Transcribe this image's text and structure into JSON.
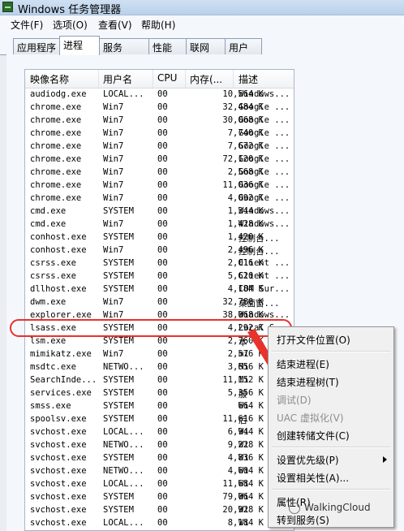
{
  "window": {
    "title": "Windows 任务管理器"
  },
  "menu": [
    "文件(F)",
    "选项(O)",
    "查看(V)",
    "帮助(H)"
  ],
  "tabs": [
    "应用程序",
    "进程",
    "服务",
    "性能",
    "联网",
    "用户"
  ],
  "active_tab": "进程",
  "columns": [
    "映像名称",
    "用户名",
    "CPU",
    "内存(...",
    "描述"
  ],
  "processes": [
    {
      "name": "audiodg.exe",
      "user": "LOCAL...",
      "cpu": "00",
      "mem": "10,564 K",
      "desc": "Windows..."
    },
    {
      "name": "chrome.exe",
      "user": "Win7",
      "cpu": "00",
      "mem": "32,484 K",
      "desc": "Google ..."
    },
    {
      "name": "chrome.exe",
      "user": "Win7",
      "cpu": "00",
      "mem": "30,068 K",
      "desc": "Google ..."
    },
    {
      "name": "chrome.exe",
      "user": "Win7",
      "cpu": "00",
      "mem": "7,740 K",
      "desc": "Google ..."
    },
    {
      "name": "chrome.exe",
      "user": "Win7",
      "cpu": "00",
      "mem": "7,672 K",
      "desc": "Google ..."
    },
    {
      "name": "chrome.exe",
      "user": "Win7",
      "cpu": "00",
      "mem": "72,120 K",
      "desc": "Google ..."
    },
    {
      "name": "chrome.exe",
      "user": "Win7",
      "cpu": "00",
      "mem": "2,568 K",
      "desc": "Google ..."
    },
    {
      "name": "chrome.exe",
      "user": "Win7",
      "cpu": "00",
      "mem": "11,036 K",
      "desc": "Google ..."
    },
    {
      "name": "chrome.exe",
      "user": "Win7",
      "cpu": "00",
      "mem": "4,092 K",
      "desc": "Google ..."
    },
    {
      "name": "cmd.exe",
      "user": "SYSTEM",
      "cpu": "00",
      "mem": "1,344 K",
      "desc": "Windows..."
    },
    {
      "name": "cmd.exe",
      "user": "Win7",
      "cpu": "00",
      "mem": "1,428 K",
      "desc": "Windows..."
    },
    {
      "name": "conhost.exe",
      "user": "SYSTEM",
      "cpu": "00",
      "mem": "1,420 K",
      "desc": "控制台..."
    },
    {
      "name": "conhost.exe",
      "user": "Win7",
      "cpu": "00",
      "mem": "2,496 K",
      "desc": "控制台..."
    },
    {
      "name": "csrss.exe",
      "user": "SYSTEM",
      "cpu": "00",
      "mem": "2,016 K",
      "desc": "Client ..."
    },
    {
      "name": "csrss.exe",
      "user": "SYSTEM",
      "cpu": "00",
      "mem": "5,620 K",
      "desc": "Client ..."
    },
    {
      "name": "dllhost.exe",
      "user": "SYSTEM",
      "cpu": "00",
      "mem": "4,184 K",
      "desc": "COM Sur..."
    },
    {
      "name": "dwm.exe",
      "user": "Win7",
      "cpu": "00",
      "mem": "32,780 K",
      "desc": "桌面窗..."
    },
    {
      "name": "explorer.exe",
      "user": "Win7",
      "cpu": "00",
      "mem": "38,068 K",
      "desc": "Windows..."
    },
    {
      "name": "lsass.exe",
      "user": "SYSTEM",
      "cpu": "00",
      "mem": "4,292 K",
      "desc": "Local S..."
    },
    {
      "name": "lsm.exe",
      "user": "SYSTEM",
      "cpu": "00",
      "mem": "2,760 K",
      "desc": "本"
    },
    {
      "name": "mimikatz.exe",
      "user": "Win7",
      "cpu": "00",
      "mem": "2,576 K",
      "desc": "mi"
    },
    {
      "name": "msdtc.exe",
      "user": "NETWO...",
      "cpu": "00",
      "mem": "3,656 K",
      "desc": "Mi"
    },
    {
      "name": "SearchInde...",
      "user": "SYSTEM",
      "cpu": "00",
      "mem": "11,152 K",
      "desc": "Mi"
    },
    {
      "name": "services.exe",
      "user": "SYSTEM",
      "cpu": "00",
      "mem": "5,356 K",
      "desc": "服"
    },
    {
      "name": "smss.exe",
      "user": "SYSTEM",
      "cpu": "00",
      "mem": "664 K",
      "desc": "Wi"
    },
    {
      "name": "spoolsv.exe",
      "user": "SYSTEM",
      "cpu": "00",
      "mem": "11,616 K",
      "desc": "后"
    },
    {
      "name": "svchost.exe",
      "user": "LOCAL...",
      "cpu": "00",
      "mem": "6,944 K",
      "desc": "Wi"
    },
    {
      "name": "svchost.exe",
      "user": "NETWO...",
      "cpu": "00",
      "mem": "9,228 K",
      "desc": "Wi"
    },
    {
      "name": "svchost.exe",
      "user": "SYSTEM",
      "cpu": "00",
      "mem": "4,836 K",
      "desc": "Wi"
    },
    {
      "name": "svchost.exe",
      "user": "NETWO...",
      "cpu": "00",
      "mem": "4,604 K",
      "desc": "Wi"
    },
    {
      "name": "svchost.exe",
      "user": "LOCAL...",
      "cpu": "00",
      "mem": "11,684 K",
      "desc": "Wi"
    },
    {
      "name": "svchost.exe",
      "user": "SYSTEM",
      "cpu": "00",
      "mem": "79,064 K",
      "desc": "Wi"
    },
    {
      "name": "svchost.exe",
      "user": "SYSTEM",
      "cpu": "00",
      "mem": "20,928 K",
      "desc": "Wi"
    },
    {
      "name": "svchost.exe",
      "user": "LOCAL...",
      "cpu": "00",
      "mem": "8,184 K",
      "desc": "Wi"
    }
  ],
  "selected_process": "lsass.exe",
  "context_menu": {
    "open_location": "打开文件位置(O)",
    "end_process": "结束进程(E)",
    "end_tree": "结束进程树(T)",
    "debug": "调试(D)",
    "uac_virtualization": "UAC 虚拟化(V)",
    "create_dump": "创建转储文件(C)",
    "set_priority": "设置优先级(P)",
    "set_affinity": "设置相关性(A)...",
    "properties": "属性(R)",
    "go_to_service": "转到服务(S)"
  },
  "watermark": "WalkingCloud",
  "colors": {
    "highlight": "#e8322c",
    "titlebar": "#b9d1ea"
  }
}
